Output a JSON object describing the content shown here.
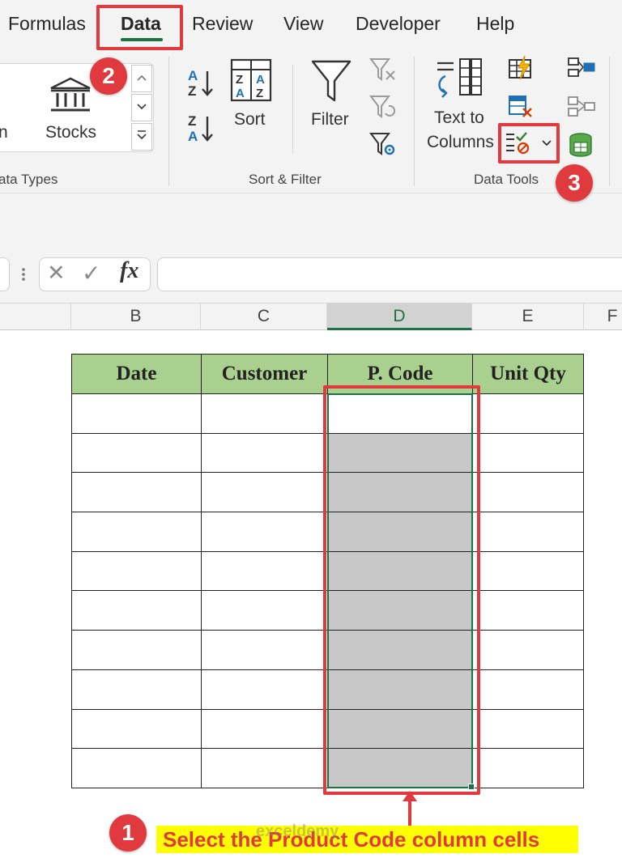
{
  "menu": {
    "tabs": [
      {
        "label": "Formulas"
      },
      {
        "label": "Data"
      },
      {
        "label": "Review"
      },
      {
        "label": "View"
      },
      {
        "label": "Developer"
      },
      {
        "label": "Help"
      }
    ],
    "active_tab": "Data"
  },
  "ribbon": {
    "data_types": {
      "partial_left_label": "n",
      "stocks_label": "Stocks",
      "group_label": "ata Types"
    },
    "sort_filter": {
      "sort_label": "Sort",
      "filter_label": "Filter",
      "group_label": "Sort & Filter"
    },
    "data_tools": {
      "text_to_columns_line1": "Text to",
      "text_to_columns_line2": "Columns",
      "group_label": "Data Tools"
    }
  },
  "formula_bar": {
    "cancel_glyph": "✕",
    "enter_glyph": "✓",
    "fx_label": "fx",
    "value": ""
  },
  "column_headers": [
    "B",
    "C",
    "D",
    "E",
    "F"
  ],
  "selected_column": "D",
  "table": {
    "headers": [
      "Date",
      "Customer",
      "P. Code",
      "Unit Qty"
    ],
    "row_count": 10
  },
  "annotations": {
    "step1": "1",
    "step2": "2",
    "step3": "3",
    "caption": "Select the Product Code column cells",
    "watermark": "exceldemy"
  },
  "colors": {
    "accent_green": "#1e7145",
    "header_fill": "#a9d08e",
    "highlight_red": "#e0393e",
    "caption_yellow": "#ffff00",
    "selection_gray": "#c8c8c8"
  }
}
